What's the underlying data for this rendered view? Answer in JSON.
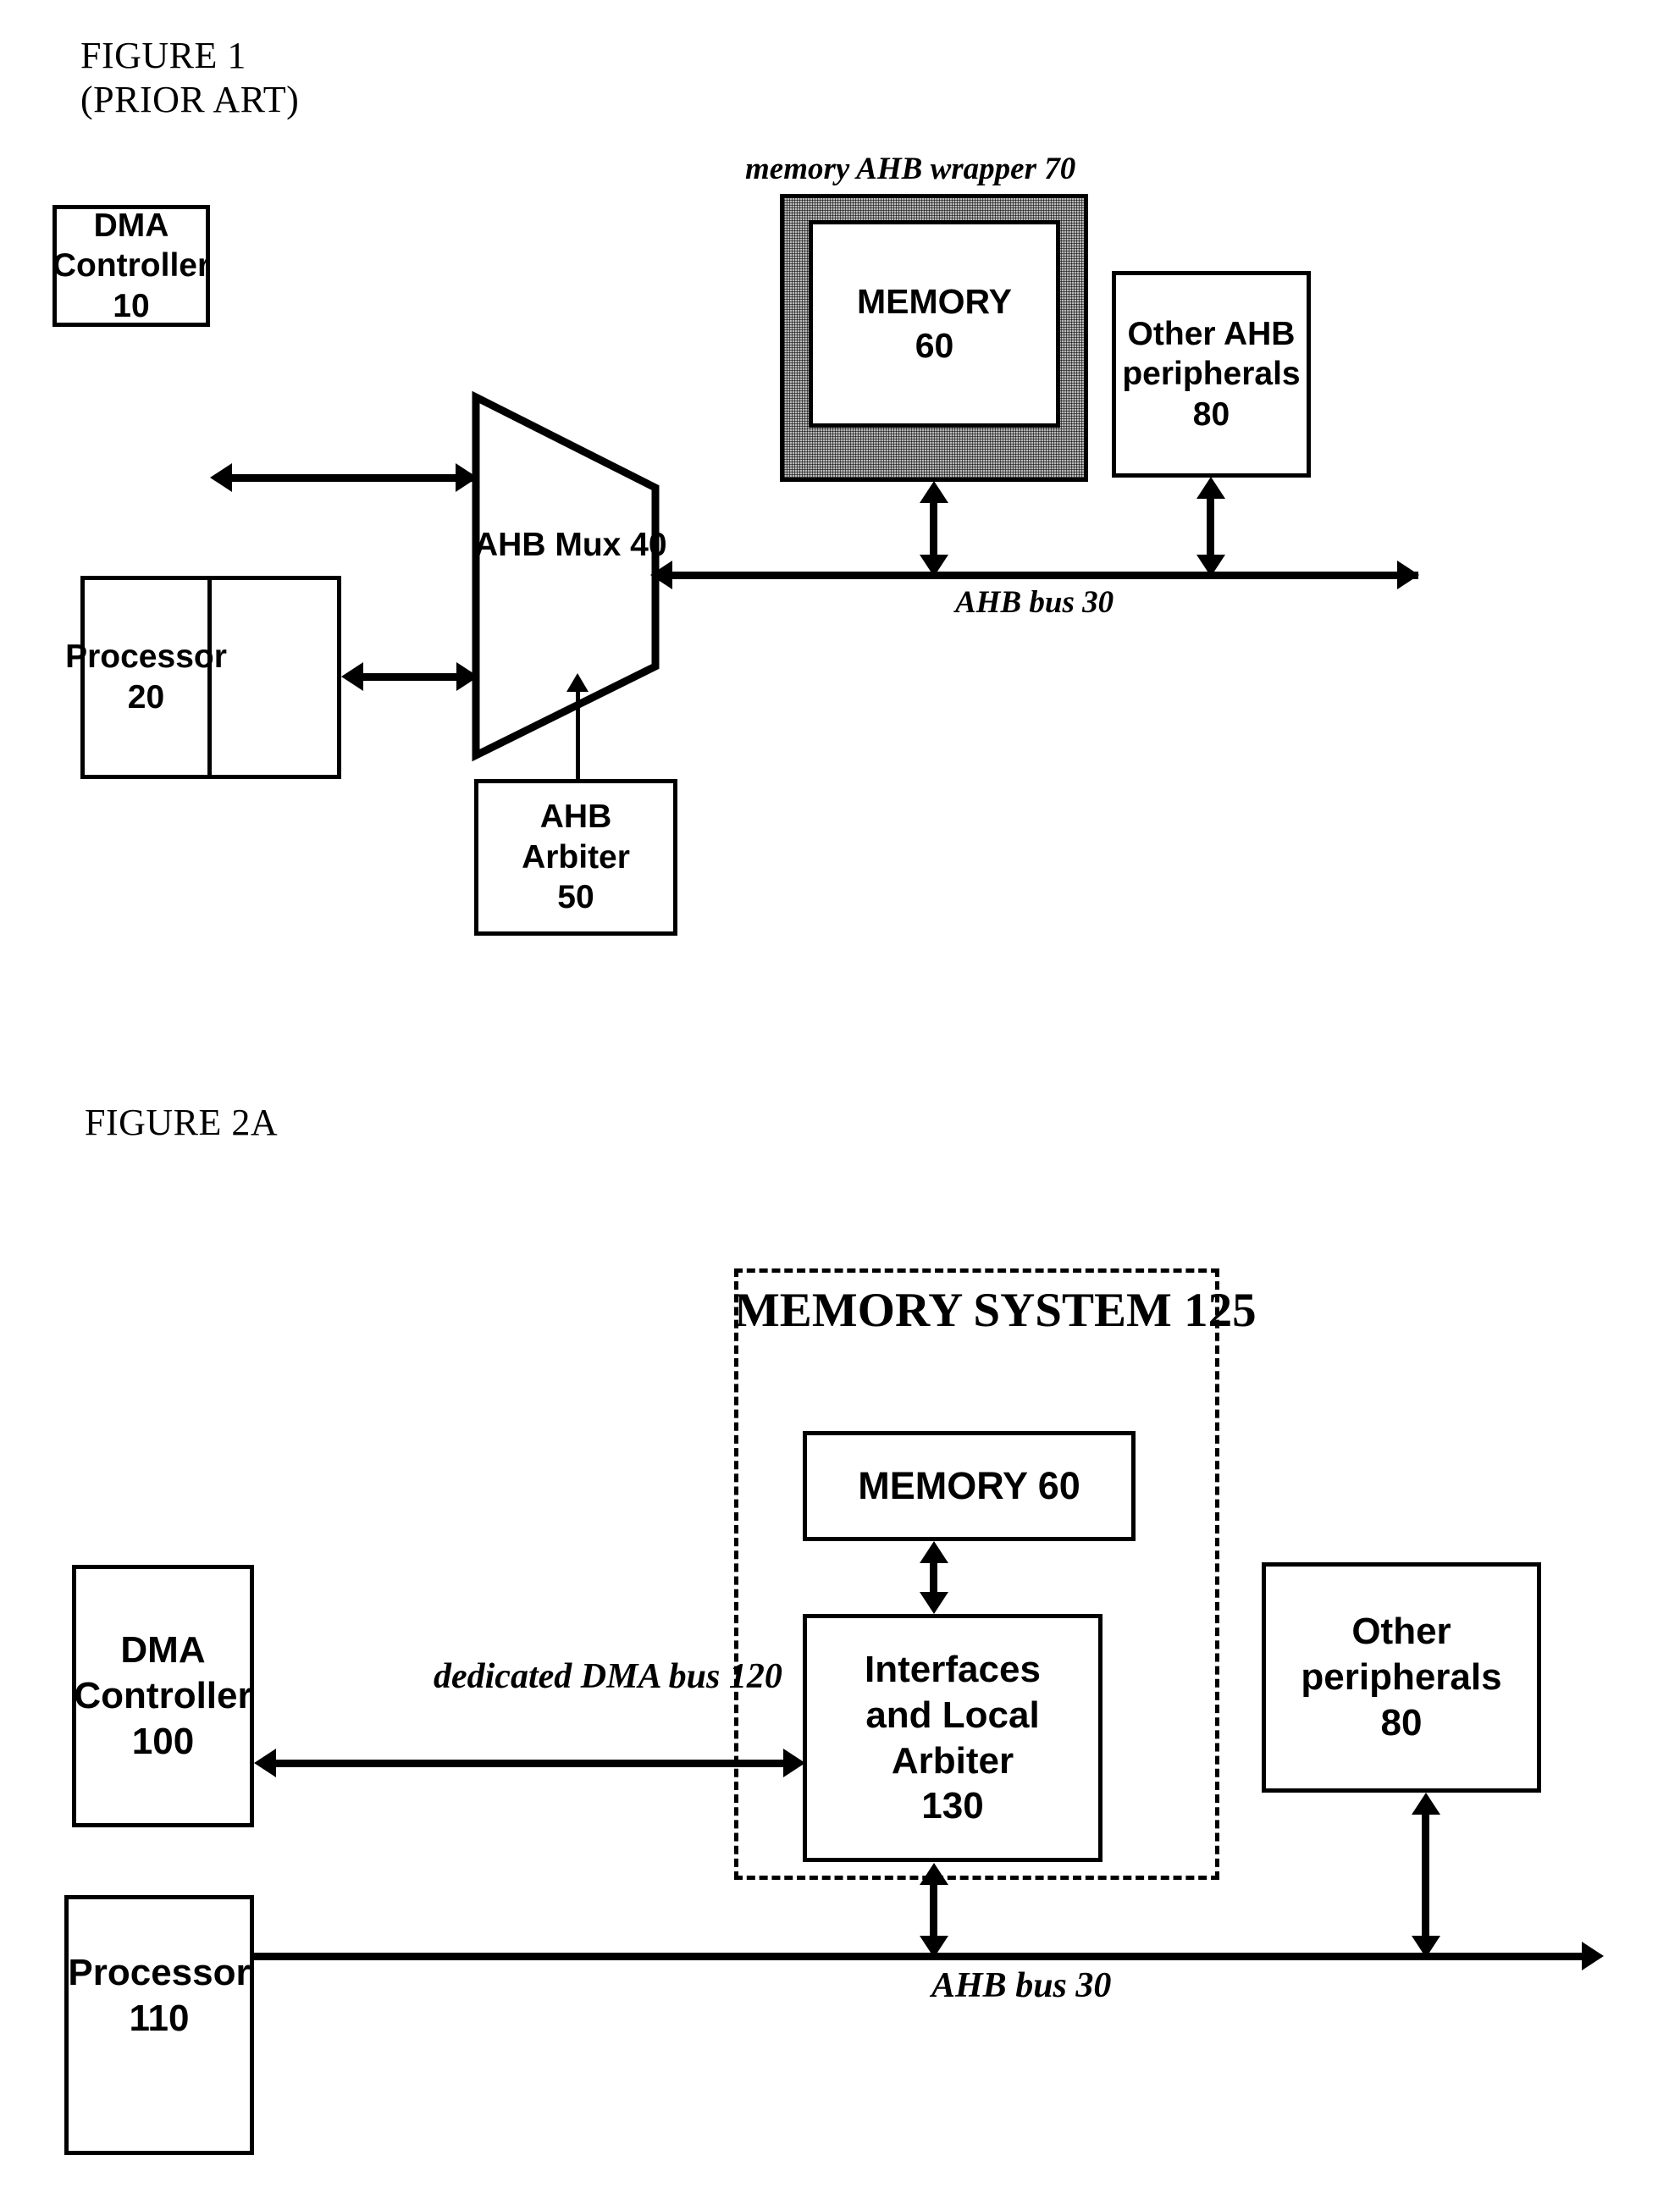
{
  "figures": [
    {
      "caption_line1": "FIGURE 1",
      "caption_line2": "(PRIOR ART)"
    },
    {
      "caption_line1": "FIGURE 2A"
    }
  ],
  "figure1": {
    "caption_line1": "FIGURE 1",
    "caption_line2": "(PRIOR ART)",
    "wrapper_label": "memory AHB wrapper 70",
    "bus_label": "AHB bus 30",
    "blocks": {
      "dma_controller": {
        "line1": "DMA",
        "line2": "Controller",
        "line3": "10"
      },
      "processor": {
        "line1": "Processor",
        "line2": "20"
      },
      "ahb_mux": {
        "line1": "AHB",
        "line2": "Mux 40"
      },
      "ahb_arbiter": {
        "line1": "AHB",
        "line2": "Arbiter",
        "line3": "50"
      },
      "memory": {
        "line1": "MEMORY",
        "line2": "60"
      },
      "other_peripherals": {
        "line1": "Other AHB",
        "line2": "peripherals",
        "line3": "80"
      }
    }
  },
  "figure2a": {
    "caption_line1": "FIGURE 2A",
    "system_title_line1": "MEMORY",
    "system_title_line2": "SYSTEM 125",
    "dma_bus_label_line1": "dedicated",
    "dma_bus_label_line2": "DMA bus",
    "dma_bus_label_line3": "120",
    "bus_label": "AHB bus 30",
    "blocks": {
      "memory": {
        "line1": "MEMORY 60"
      },
      "interfaces": {
        "line1": "Interfaces",
        "line2": "and Local",
        "line3": "Arbiter",
        "line4": "130"
      },
      "dma_controller": {
        "line1": "DMA",
        "line2": "Controller",
        "line3": "100"
      },
      "processor": {
        "line1": "Processor",
        "line2": "110"
      },
      "other_peripherals": {
        "line1": "Other",
        "line2": "peripherals",
        "line3": "80"
      }
    }
  },
  "colors": {
    "ink": "#000000",
    "paper": "#ffffff",
    "wrapper_fill": "#b9b9b9"
  }
}
